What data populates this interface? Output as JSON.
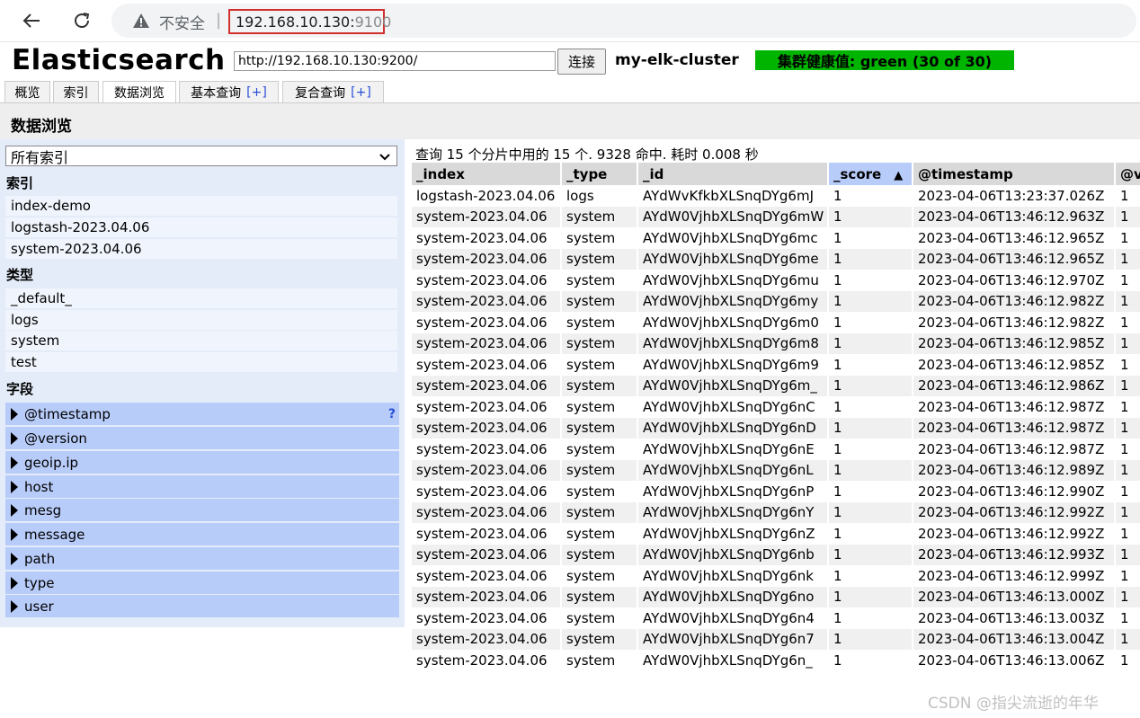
{
  "browser": {
    "security_label": "不安全",
    "separator": "|",
    "url_host": "192.168.10.130:",
    "url_port": "9100"
  },
  "app": {
    "title": "Elasticsearch",
    "cluster_url": "http://192.168.10.130:9200/",
    "connect_label": "连接",
    "cluster_name": "my-elk-cluster",
    "health_text": "集群健康值: green (30 of 30)",
    "health_color": "#00b400"
  },
  "tabs": [
    {
      "label": "概览"
    },
    {
      "label": "索引"
    },
    {
      "label": "数据浏览"
    },
    {
      "label": "基本查询",
      "plus": "[+]"
    },
    {
      "label": "复合查询",
      "plus": "[+]"
    }
  ],
  "section_title": "数据浏览",
  "sidebar": {
    "index_select": "所有索引",
    "indices_label": "索引",
    "indices": [
      "index-demo",
      "logstash-2023.04.06",
      "system-2023.04.06"
    ],
    "types_label": "类型",
    "types": [
      "_default_",
      "logs",
      "system",
      "test"
    ],
    "fields_label": "字段",
    "fields": [
      "@timestamp",
      "@version",
      "geoip.ip",
      "host",
      "mesg",
      "message",
      "path",
      "type",
      "user"
    ],
    "help_mark": "?"
  },
  "results": {
    "summary": "查询 15 个分片中用的 15 个. 9328 命中. 耗时 0.008 秒",
    "columns": [
      "_index",
      "_type",
      "_id",
      "_score",
      "@timestamp",
      "@v"
    ],
    "sort_arrow": "▲",
    "rows": [
      [
        "logstash-2023.04.06",
        "logs",
        "AYdWvKfkbXLSnqDYg6mJ",
        "1",
        "2023-04-06T13:23:37.026Z",
        "1"
      ],
      [
        "system-2023.04.06",
        "system",
        "AYdW0VjhbXLSnqDYg6mW",
        "1",
        "2023-04-06T13:46:12.963Z",
        "1"
      ],
      [
        "system-2023.04.06",
        "system",
        "AYdW0VjhbXLSnqDYg6mc",
        "1",
        "2023-04-06T13:46:12.965Z",
        "1"
      ],
      [
        "system-2023.04.06",
        "system",
        "AYdW0VjhbXLSnqDYg6me",
        "1",
        "2023-04-06T13:46:12.965Z",
        "1"
      ],
      [
        "system-2023.04.06",
        "system",
        "AYdW0VjhbXLSnqDYg6mu",
        "1",
        "2023-04-06T13:46:12.970Z",
        "1"
      ],
      [
        "system-2023.04.06",
        "system",
        "AYdW0VjhbXLSnqDYg6my",
        "1",
        "2023-04-06T13:46:12.982Z",
        "1"
      ],
      [
        "system-2023.04.06",
        "system",
        "AYdW0VjhbXLSnqDYg6m0",
        "1",
        "2023-04-06T13:46:12.982Z",
        "1"
      ],
      [
        "system-2023.04.06",
        "system",
        "AYdW0VjhbXLSnqDYg6m8",
        "1",
        "2023-04-06T13:46:12.985Z",
        "1"
      ],
      [
        "system-2023.04.06",
        "system",
        "AYdW0VjhbXLSnqDYg6m9",
        "1",
        "2023-04-06T13:46:12.985Z",
        "1"
      ],
      [
        "system-2023.04.06",
        "system",
        "AYdW0VjhbXLSnqDYg6m_",
        "1",
        "2023-04-06T13:46:12.986Z",
        "1"
      ],
      [
        "system-2023.04.06",
        "system",
        "AYdW0VjhbXLSnqDYg6nC",
        "1",
        "2023-04-06T13:46:12.987Z",
        "1"
      ],
      [
        "system-2023.04.06",
        "system",
        "AYdW0VjhbXLSnqDYg6nD",
        "1",
        "2023-04-06T13:46:12.987Z",
        "1"
      ],
      [
        "system-2023.04.06",
        "system",
        "AYdW0VjhbXLSnqDYg6nE",
        "1",
        "2023-04-06T13:46:12.987Z",
        "1"
      ],
      [
        "system-2023.04.06",
        "system",
        "AYdW0VjhbXLSnqDYg6nL",
        "1",
        "2023-04-06T13:46:12.989Z",
        "1"
      ],
      [
        "system-2023.04.06",
        "system",
        "AYdW0VjhbXLSnqDYg6nP",
        "1",
        "2023-04-06T13:46:12.990Z",
        "1"
      ],
      [
        "system-2023.04.06",
        "system",
        "AYdW0VjhbXLSnqDYg6nY",
        "1",
        "2023-04-06T13:46:12.992Z",
        "1"
      ],
      [
        "system-2023.04.06",
        "system",
        "AYdW0VjhbXLSnqDYg6nZ",
        "1",
        "2023-04-06T13:46:12.992Z",
        "1"
      ],
      [
        "system-2023.04.06",
        "system",
        "AYdW0VjhbXLSnqDYg6nb",
        "1",
        "2023-04-06T13:46:12.993Z",
        "1"
      ],
      [
        "system-2023.04.06",
        "system",
        "AYdW0VjhbXLSnqDYg6nk",
        "1",
        "2023-04-06T13:46:12.999Z",
        "1"
      ],
      [
        "system-2023.04.06",
        "system",
        "AYdW0VjhbXLSnqDYg6no",
        "1",
        "2023-04-06T13:46:13.000Z",
        "1"
      ],
      [
        "system-2023.04.06",
        "system",
        "AYdW0VjhbXLSnqDYg6n4",
        "1",
        "2023-04-06T13:46:13.003Z",
        "1"
      ],
      [
        "system-2023.04.06",
        "system",
        "AYdW0VjhbXLSnqDYg6n7",
        "1",
        "2023-04-06T13:46:13.004Z",
        "1"
      ],
      [
        "system-2023.04.06",
        "system",
        "AYdW0VjhbXLSnqDYg6n_",
        "1",
        "2023-04-06T13:46:13.006Z",
        "1"
      ]
    ]
  },
  "watermark": "CSDN @指尖流逝的年华"
}
